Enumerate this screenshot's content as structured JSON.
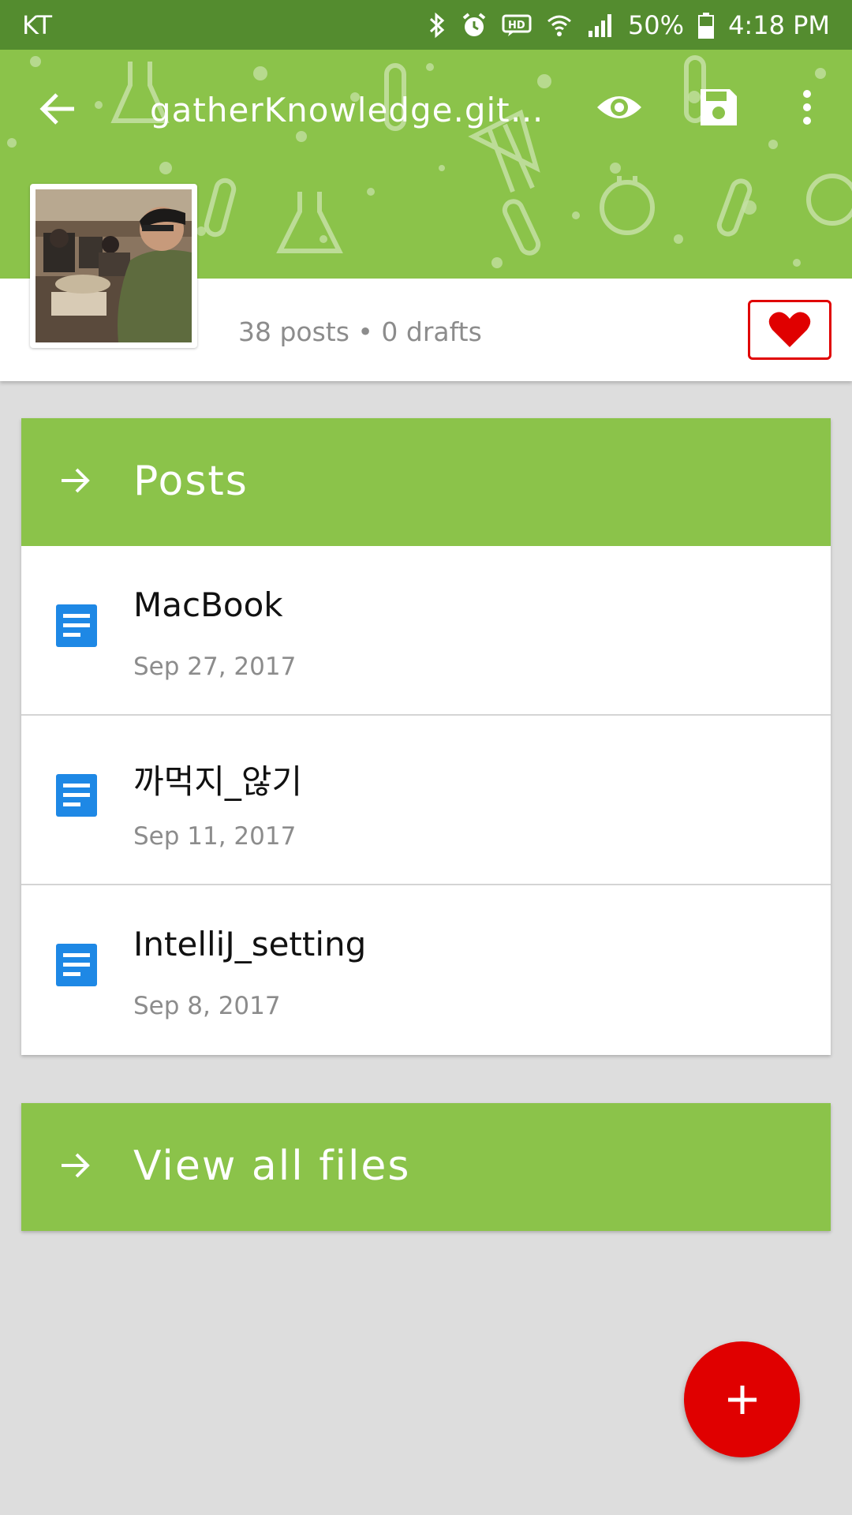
{
  "status_bar": {
    "carrier": "KT",
    "battery": "50%",
    "time": "4:18 PM"
  },
  "toolbar": {
    "title": "gatherKnowledge.git…",
    "icons": [
      "back-arrow-icon",
      "eye-icon",
      "save-icon",
      "more-vert-icon"
    ]
  },
  "profile": {
    "stats": "38 posts • 0 drafts"
  },
  "posts_section": {
    "header": "Posts",
    "items": [
      {
        "title": "MacBook",
        "date": "Sep 27, 2017"
      },
      {
        "title": "까먹지_않기",
        "date": "Sep 11, 2017"
      },
      {
        "title": "IntelliJ_setting",
        "date": "Sep 8, 2017"
      }
    ]
  },
  "files_section": {
    "header": "View all files"
  },
  "colors": {
    "status_bar": "#548c2f",
    "accent_green": "#8bc34a",
    "red": "#e00000",
    "doc_blue": "#1e88e5",
    "background": "#dddddd"
  }
}
